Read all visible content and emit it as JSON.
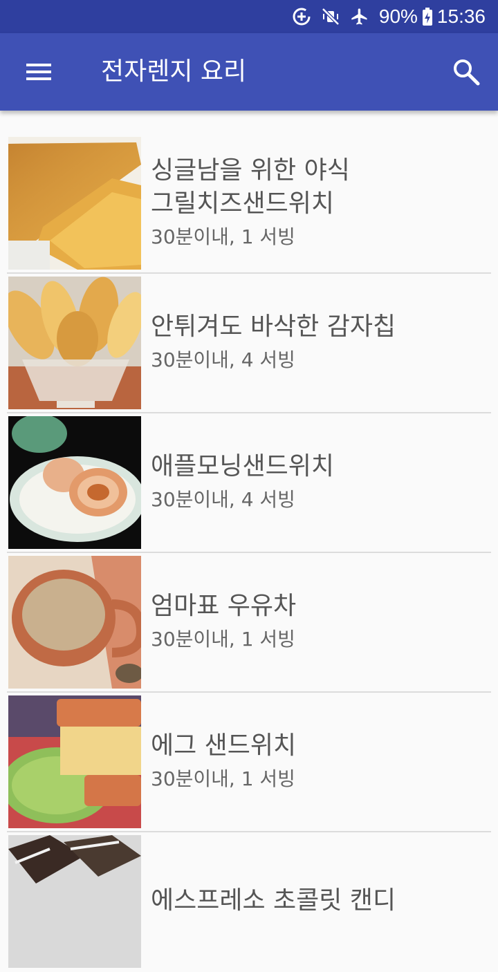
{
  "status_bar": {
    "battery": "90%",
    "time": "15:36",
    "icons": [
      "data-saver-icon",
      "vibrate-mute-icon",
      "airplane-icon",
      "battery-charging-icon"
    ]
  },
  "app_bar": {
    "title": "전자렌지 요리",
    "menu_icon": "hamburger-menu-icon",
    "search_icon": "search-icon"
  },
  "recipes": [
    {
      "title_line1": "싱글남을 위한 야식",
      "title_line2": "그릴치즈샌드위치",
      "meta": "30분이내, 1 서빙",
      "image": "grilled-cheese-sandwich"
    },
    {
      "title_line1": "안튀겨도 바삭한 감자칩",
      "title_line2": "",
      "meta": "30분이내, 4 서빙",
      "image": "potato-chips"
    },
    {
      "title_line1": "애플모닝샌드위치",
      "title_line2": "",
      "meta": "30분이내, 4 서빙",
      "image": "apple-morning-sandwich"
    },
    {
      "title_line1": "엄마표 우유차",
      "title_line2": "",
      "meta": "30분이내, 1 서빙",
      "image": "milk-tea"
    },
    {
      "title_line1": "에그 샌드위치",
      "title_line2": "",
      "meta": "30분이내, 1 서빙",
      "image": "egg-sandwich"
    },
    {
      "title_line1": "에스프레소 초콜릿 캔디",
      "title_line2": "",
      "meta": "",
      "image": "espresso-chocolate-candy"
    }
  ]
}
